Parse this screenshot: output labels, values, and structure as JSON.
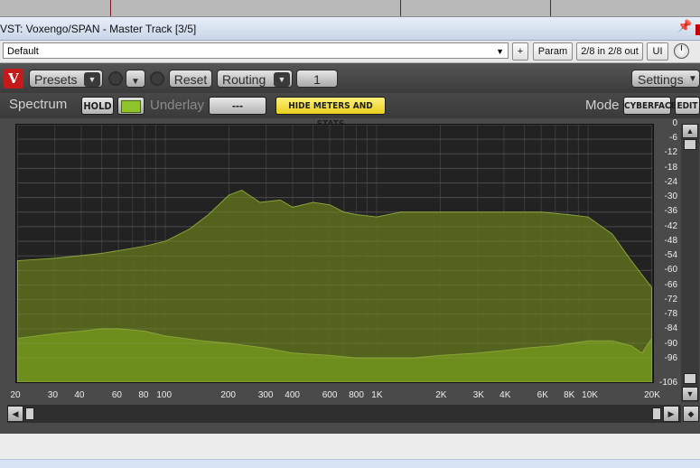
{
  "window": {
    "title": "VST: Voxengo/SPAN - Master Track [3/5]",
    "pin_icon": "pin-icon"
  },
  "host": {
    "preset_value": "Default",
    "add_label": "+",
    "param_label": "Param",
    "io_label": "2/8 in 2/8 out",
    "ui_label": "UI"
  },
  "plugin": {
    "presets_label": "Presets",
    "reset_label": "Reset",
    "routing_label": "Routing",
    "routing_value": "1",
    "settings_label": "Settings",
    "spectrum_label": "Spectrum",
    "hold_label": "HOLD",
    "hold_color": "#8ec42a",
    "underlay_label": "Underlay",
    "underlay_value": "---",
    "hide_meters_label": "HIDE METERS AND STATS",
    "hide_meters_color": "#f5e33a",
    "mode_label": "Mode",
    "mode_value": "CYBERFACE",
    "edit_label": "EDIT"
  },
  "colors": {
    "spectrum_fill": "#5c6f1c",
    "spectrum_line": "#8aa338",
    "underlay_fill": "#6f8f1e",
    "plot_bg": "#222222"
  },
  "chart_data": {
    "type": "area",
    "x_scale": "log",
    "xlim": [
      20,
      20000
    ],
    "ylim": [
      -106,
      0
    ],
    "y_unit": "dB",
    "grid": true,
    "x_tick_labels": [
      "20",
      "30",
      "40",
      "60",
      "80",
      "100",
      "200",
      "300",
      "400",
      "600",
      "800",
      "1K",
      "2K",
      "3K",
      "4K",
      "6K",
      "8K",
      "10K",
      "20K"
    ],
    "x_tick_values": [
      20,
      30,
      40,
      60,
      80,
      100,
      200,
      300,
      400,
      600,
      800,
      1000,
      2000,
      3000,
      4000,
      6000,
      8000,
      10000,
      20000
    ],
    "y_tick_labels": [
      "0",
      "-6",
      "-12",
      "-18",
      "-24",
      "-30",
      "-36",
      "-42",
      "-48",
      "-54",
      "-60",
      "-66",
      "-72",
      "-78",
      "-84",
      "-90",
      "-96",
      "-106"
    ],
    "y_tick_values": [
      0,
      -6,
      -12,
      -18,
      -24,
      -30,
      -36,
      -42,
      -48,
      -54,
      -60,
      -66,
      -72,
      -78,
      -84,
      -90,
      -96,
      -106
    ],
    "series": [
      {
        "x": [
          20,
          30,
          50,
          80,
          100,
          130,
          160,
          200,
          230,
          280,
          350,
          400,
          500,
          600,
          700,
          800,
          1000,
          1300,
          1600,
          2000,
          2500,
          3000,
          4000,
          5000,
          6000,
          8000,
          10000,
          13000,
          16000,
          20000
        ],
        "y": [
          -56,
          -55,
          -53,
          -50,
          -48,
          -43,
          -37,
          -29,
          -27,
          -32,
          -31,
          -34,
          -32,
          -33,
          -36,
          -37,
          -38,
          -36,
          -36,
          -36,
          -36,
          -36,
          -36,
          -36,
          -36,
          -37,
          -38,
          -45,
          -56,
          -67
        ]
      },
      {
        "x": [
          20,
          30,
          40,
          50,
          60,
          80,
          100,
          150,
          200,
          300,
          400,
          600,
          800,
          1000,
          1500,
          2000,
          3000,
          4000,
          5000,
          7000,
          10000,
          13000,
          16000,
          18000,
          20000
        ],
        "y": [
          -88,
          -86,
          -85,
          -84,
          -84,
          -85,
          -87,
          -89,
          -90,
          -92,
          -94,
          -95,
          -96,
          -96,
          -96,
          -95,
          -94,
          -93,
          -92,
          -91,
          -89,
          -89,
          -91,
          -94,
          -88
        ]
      }
    ]
  }
}
